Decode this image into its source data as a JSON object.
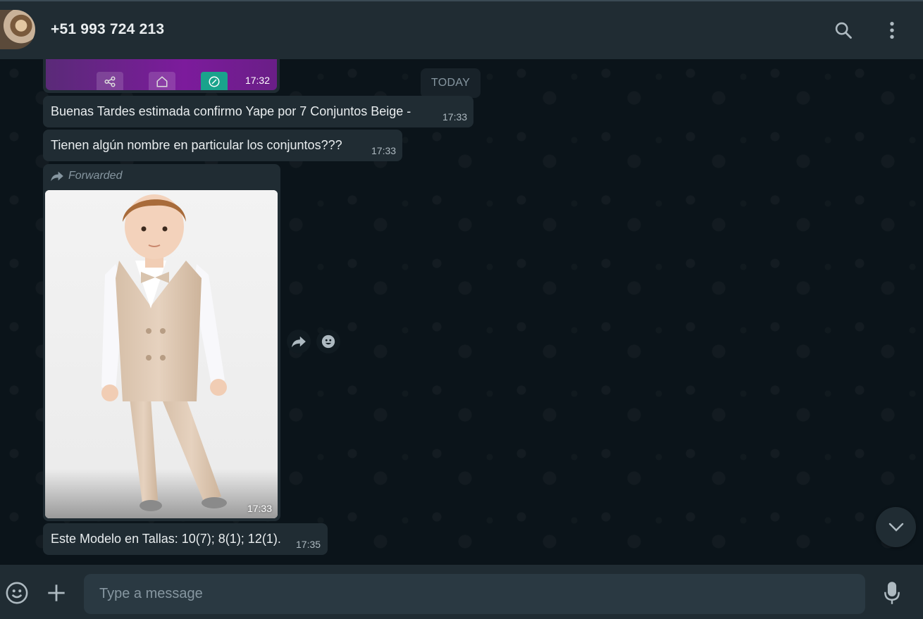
{
  "header": {
    "contact_name": "+51 993 724 213",
    "icons": [
      "contact-avatar",
      "search-icon",
      "more-options-icon"
    ]
  },
  "chat": {
    "date_separator": "TODAY",
    "previous_media": {
      "time": "17:32"
    },
    "messages": [
      {
        "text": "Buenas Tardes estimada confirmo Yape por 7 Conjuntos Beige -",
        "time": "17:33"
      },
      {
        "text": "Tienen algún nombre en particular los conjuntos???",
        "time": "17:33"
      },
      {
        "forwarded_label": "Forwarded",
        "time": "17:33",
        "type": "image"
      },
      {
        "text": "Este Modelo en Tallas: 10(7); 8(1); 12(1).",
        "time": "17:35"
      }
    ]
  },
  "composer": {
    "placeholder": "Type a message"
  },
  "colors": {
    "background": "#0b141a",
    "panel": "#202c33",
    "bubble": "#202c33",
    "input": "#2a3942",
    "muted_text": "#8696a0",
    "primary_text": "#e9edef"
  }
}
